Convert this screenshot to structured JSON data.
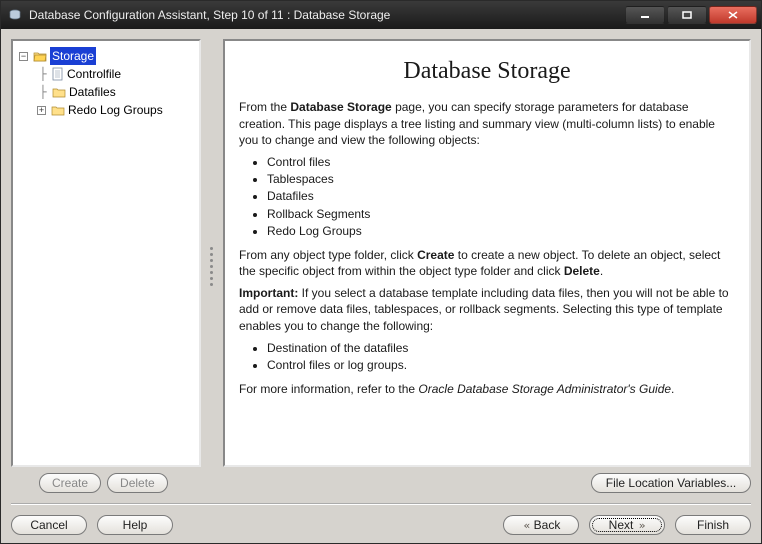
{
  "window": {
    "title": "Database Configuration Assistant, Step 10 of 11 : Database Storage"
  },
  "tree": {
    "root": {
      "label": "Storage"
    },
    "children": [
      {
        "label": "Controlfile"
      },
      {
        "label": "Datafiles"
      },
      {
        "label": "Redo Log Groups"
      }
    ]
  },
  "nav_buttons": {
    "create": "Create",
    "delete": "Delete"
  },
  "page": {
    "heading": "Database Storage",
    "intro_prefix": "From the ",
    "intro_bold": "Database Storage",
    "intro_suffix": " page, you can specify storage parameters for database creation. This page displays a tree listing and summary view (multi-column lists) to enable you to change and view the following objects:",
    "objects": [
      "Control files",
      "Tablespaces",
      "Datafiles",
      "Rollback Segments",
      "Redo Log Groups"
    ],
    "create_delete_prefix": "From any object type folder, click ",
    "create_delete_mid1": "Create",
    "create_delete_mid2": " to create a new object. To delete an object, select the specific object from within the object type folder and click ",
    "create_delete_mid3": "Delete",
    "create_delete_suffix": ".",
    "important_label": "Important:",
    "important_text": " If you select a database template including data files, then you will not be able to add or remove data files, tablespaces, or rollback segments. Selecting this type of template enables you to change the following:",
    "template_list": [
      "Destination of the datafiles",
      "Control files or log groups."
    ],
    "moreinfo_prefix": "For more information, refer to the ",
    "moreinfo_ital": "Oracle Database Storage Administrator's Guide",
    "moreinfo_suffix": "."
  },
  "right_actions": {
    "file_loc": "File Location Variables..."
  },
  "footer": {
    "cancel": "Cancel",
    "help": "Help",
    "back": "Back",
    "next": "Next",
    "finish": "Finish"
  }
}
